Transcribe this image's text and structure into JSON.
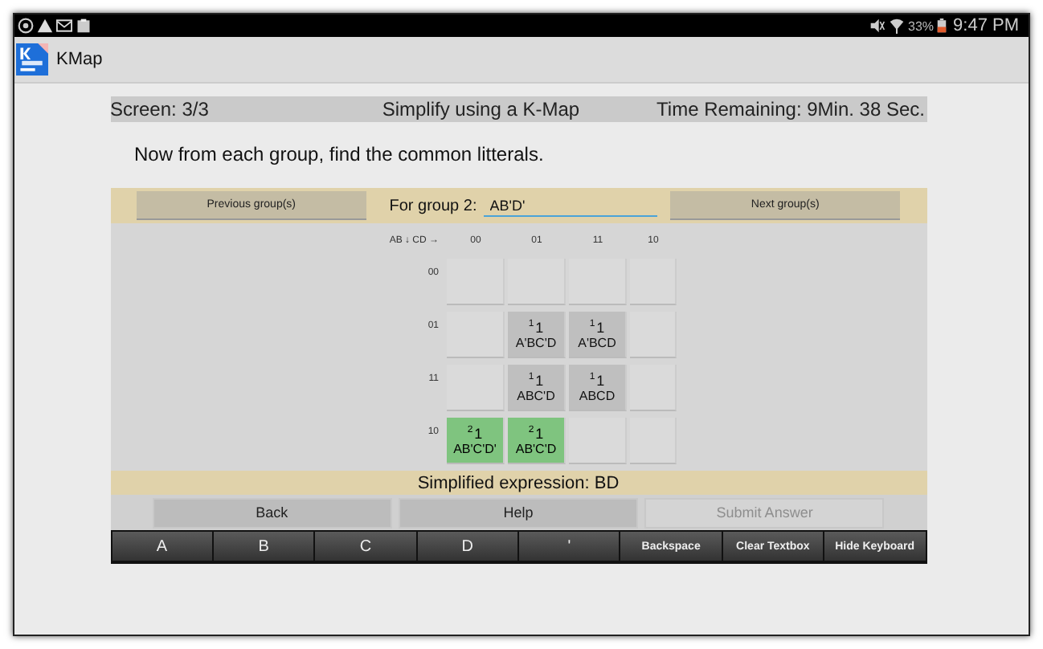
{
  "status_bar": {
    "battery": "33%",
    "time": "9:47 PM"
  },
  "app_bar": {
    "title": "KMap"
  },
  "header": {
    "screen": "Screen: 3/3",
    "title": "Simplify using a K-Map",
    "timer": "Time Remaining: 9Min. 38 Sec."
  },
  "instruction": "Now from each group, find the common litterals.",
  "group_bar": {
    "previous": "Previous group(s)",
    "label": "For group 2:",
    "value": "AB'D'",
    "next": "Next group(s)"
  },
  "kmap": {
    "corner": "AB ↓ CD →",
    "columns": [
      "00",
      "01",
      "11",
      "10"
    ],
    "rows": [
      {
        "label": "00",
        "cells": [
          {},
          {},
          {},
          {}
        ]
      },
      {
        "label": "01",
        "cells": [
          {},
          {
            "group": "1",
            "value": "1",
            "term": "A'BC'D",
            "highlighted": false
          },
          {
            "group": "1",
            "value": "1",
            "term": "A'BCD",
            "highlighted": false
          },
          {}
        ]
      },
      {
        "label": "11",
        "cells": [
          {},
          {
            "group": "1",
            "value": "1",
            "term": "ABC'D",
            "highlighted": false
          },
          {
            "group": "1",
            "value": "1",
            "term": "ABCD",
            "highlighted": false
          },
          {}
        ]
      },
      {
        "label": "10",
        "cells": [
          {
            "group": "2",
            "value": "1",
            "term": "AB'C'D'",
            "highlighted": true
          },
          {
            "group": "2",
            "value": "1",
            "term": "AB'C'D",
            "highlighted": true
          },
          {},
          {}
        ]
      }
    ]
  },
  "result": "Simplified expression: BD",
  "buttons": [
    {
      "label": "Back",
      "disabled": false
    },
    {
      "label": "Help",
      "disabled": false
    },
    {
      "label": "Submit Answer",
      "disabled": true
    }
  ],
  "keyboard": [
    {
      "label": "A",
      "kind": "big"
    },
    {
      "label": "B",
      "kind": "big"
    },
    {
      "label": "C",
      "kind": "big"
    },
    {
      "label": "D",
      "kind": "big"
    },
    {
      "label": "'",
      "kind": "big"
    },
    {
      "label": "Backspace",
      "kind": "small"
    },
    {
      "label": "Clear Textbox",
      "kind": "small"
    },
    {
      "label": "Hide Keyboard",
      "kind": "small"
    }
  ]
}
